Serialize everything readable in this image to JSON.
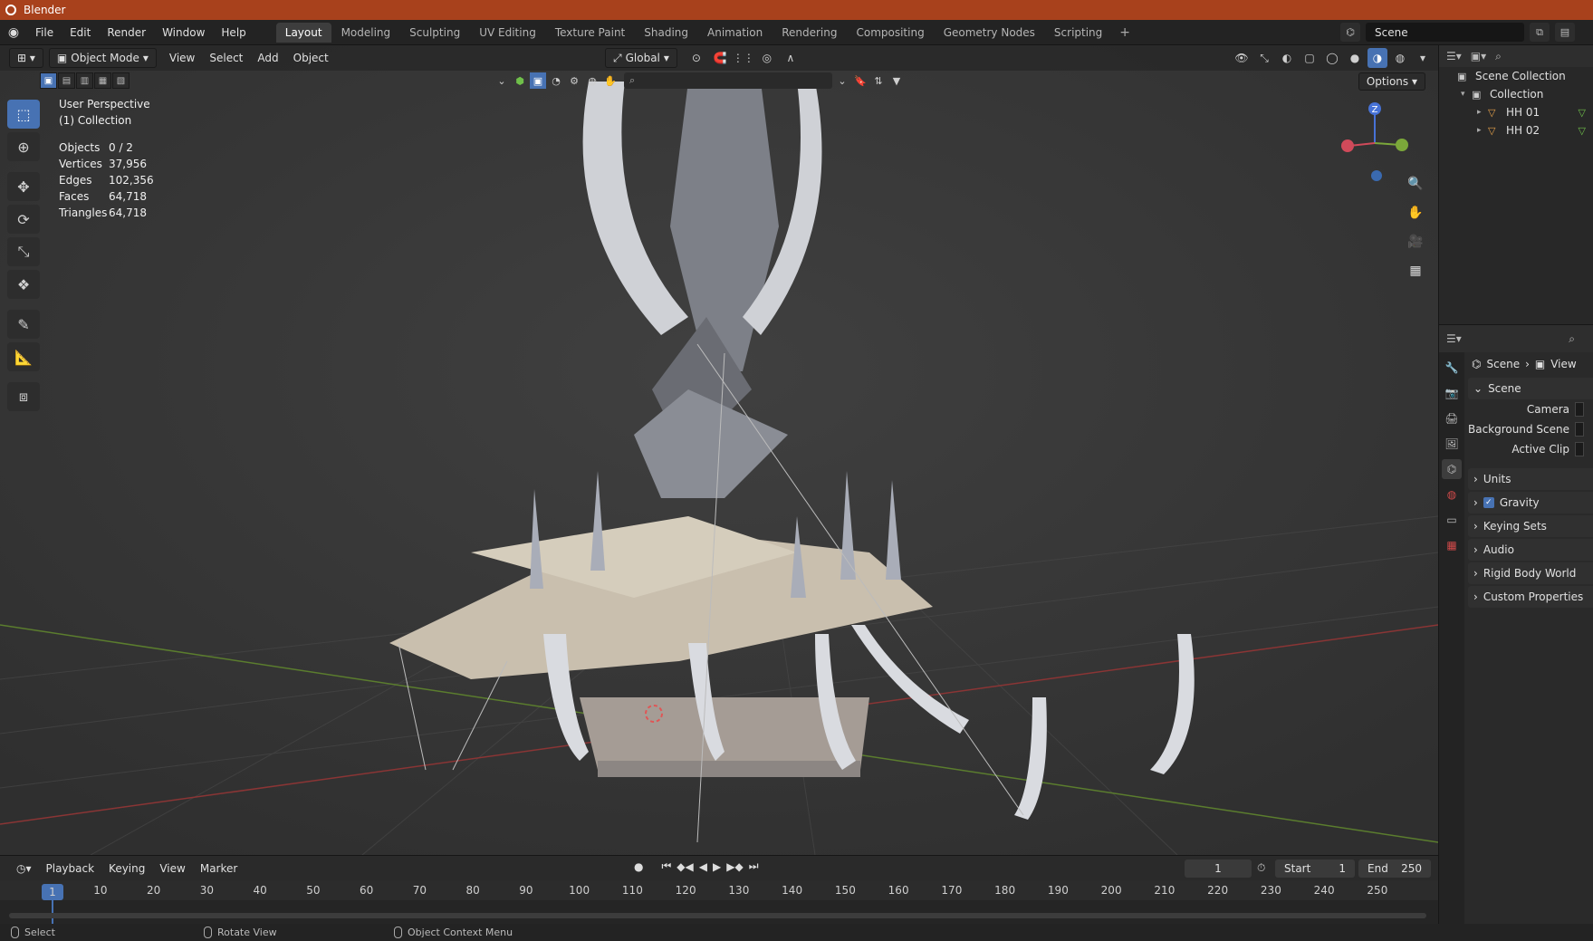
{
  "window": {
    "title": "Blender"
  },
  "menu": [
    "File",
    "Edit",
    "Render",
    "Window",
    "Help"
  ],
  "workspaces": [
    "Layout",
    "Modeling",
    "Sculpting",
    "UV Editing",
    "Texture Paint",
    "Shading",
    "Animation",
    "Rendering",
    "Compositing",
    "Geometry Nodes",
    "Scripting"
  ],
  "active_workspace": "Layout",
  "scene_name": "Scene",
  "viewport": {
    "mode": "Object Mode",
    "menus": [
      "View",
      "Select",
      "Add",
      "Object"
    ],
    "transform_orientation": "Global",
    "options_label": "Options",
    "perspective": "User Perspective",
    "collection": "(1) Collection",
    "stats": [
      {
        "label": "Objects",
        "value": "0 / 2"
      },
      {
        "label": "Vertices",
        "value": "37,956"
      },
      {
        "label": "Edges",
        "value": "102,356"
      },
      {
        "label": "Faces",
        "value": "64,718"
      },
      {
        "label": "Triangles",
        "value": "64,718"
      }
    ],
    "gizmo_axis_label": "Z"
  },
  "outliner": {
    "root": "Scene Collection",
    "collection": "Collection",
    "objects": [
      "HH 01",
      "HH 02"
    ]
  },
  "properties": {
    "breadcrumb_scene": "Scene",
    "breadcrumb_view": "View",
    "panel_scene": "Scene",
    "fields": [
      "Camera",
      "Background Scene",
      "Active Clip"
    ],
    "subpanels": [
      "Units",
      "Gravity",
      "Keying Sets",
      "Audio",
      "Rigid Body World",
      "Custom Properties"
    ]
  },
  "timeline": {
    "menus": [
      "Playback",
      "Keying",
      "View",
      "Marker"
    ],
    "current_frame": "1",
    "start_label": "Start",
    "start_value": "1",
    "end_label": "End",
    "end_value": "250",
    "ticks": [
      "10",
      "20",
      "30",
      "40",
      "50",
      "60",
      "70",
      "80",
      "90",
      "100",
      "110",
      "120",
      "130",
      "140",
      "150",
      "160",
      "170",
      "180",
      "190",
      "200",
      "210",
      "220",
      "230",
      "240",
      "250"
    ]
  },
  "status": {
    "select": "Select",
    "rotate": "Rotate View",
    "context": "Object Context Menu"
  }
}
